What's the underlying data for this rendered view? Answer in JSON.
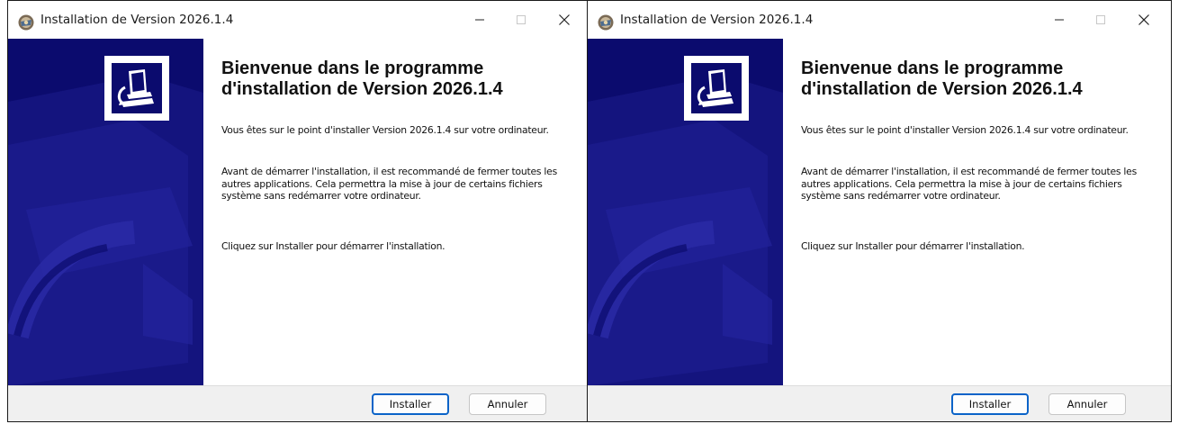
{
  "installer": {
    "window_title": "Installation de Version 2026.1.4",
    "heading": "Bienvenue dans le programme d'installation de Version 2026.1.4",
    "paragraph1": "Vous êtes sur le point d'installer Version 2026.1.4 sur votre ordinateur.",
    "paragraph2": "Avant de démarrer l'installation, il est recommandé de fermer toutes les autres applications. Cela permettra la mise à jour de certains fichiers système sans redémarrer votre ordinateur.",
    "paragraph3": "Cliquez sur Installer pour démarrer l'installation.",
    "install_button": "Installer",
    "cancel_button": "Annuler",
    "icons": {
      "app": "installer-app-icon",
      "minimize": "minimize-icon",
      "maximize": "maximize-icon",
      "close": "close-icon",
      "banner_logo": "computer-install-icon"
    },
    "colors": {
      "banner_bg": "#0b0b6e",
      "footer_bg": "#f0f0f0",
      "primary_button_border": "#0a63c8"
    }
  }
}
